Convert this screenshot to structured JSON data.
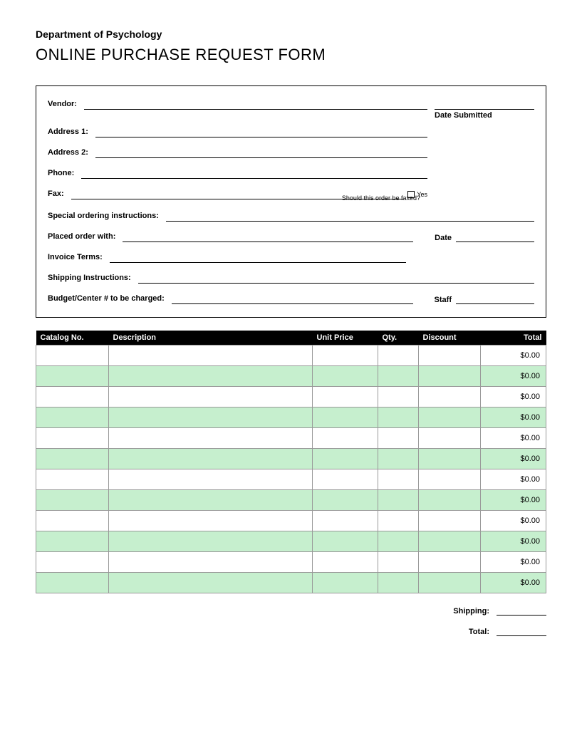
{
  "header": {
    "department": "Department of Psychology",
    "title": "ONLINE PURCHASE REQUEST FORM"
  },
  "form": {
    "vendor_label": "Vendor:",
    "date_submitted_label": "Date Submitted",
    "address1_label": "Address 1:",
    "address2_label": "Address 2:",
    "phone_label": "Phone:",
    "fax_label": "Fax:",
    "fax_yes": "Yes",
    "fax_hint": "Should this order be faxed?",
    "special_label": "Special ordering instructions:",
    "placed_label": "Placed order with:",
    "date_label": "Date",
    "invoice_label": "Invoice Terms:",
    "shipping_label": "Shipping Instructions:",
    "budget_label": "Budget/Center # to be charged:",
    "staff_label": "Staff"
  },
  "table": {
    "headers": {
      "catalog": "Catalog No.",
      "description": "Description",
      "unit_price": "Unit Price",
      "qty": "Qty.",
      "discount": "Discount",
      "total": "Total"
    },
    "rows": [
      {
        "catalog": "",
        "description": "",
        "unit_price": "",
        "qty": "",
        "discount": "",
        "total": "$0.00"
      },
      {
        "catalog": "",
        "description": "",
        "unit_price": "",
        "qty": "",
        "discount": "",
        "total": "$0.00"
      },
      {
        "catalog": "",
        "description": "",
        "unit_price": "",
        "qty": "",
        "discount": "",
        "total": "$0.00"
      },
      {
        "catalog": "",
        "description": "",
        "unit_price": "",
        "qty": "",
        "discount": "",
        "total": "$0.00"
      },
      {
        "catalog": "",
        "description": "",
        "unit_price": "",
        "qty": "",
        "discount": "",
        "total": "$0.00"
      },
      {
        "catalog": "",
        "description": "",
        "unit_price": "",
        "qty": "",
        "discount": "",
        "total": "$0.00"
      },
      {
        "catalog": "",
        "description": "",
        "unit_price": "",
        "qty": "",
        "discount": "",
        "total": "$0.00"
      },
      {
        "catalog": "",
        "description": "",
        "unit_price": "",
        "qty": "",
        "discount": "",
        "total": "$0.00"
      },
      {
        "catalog": "",
        "description": "",
        "unit_price": "",
        "qty": "",
        "discount": "",
        "total": "$0.00"
      },
      {
        "catalog": "",
        "description": "",
        "unit_price": "",
        "qty": "",
        "discount": "",
        "total": "$0.00"
      },
      {
        "catalog": "",
        "description": "",
        "unit_price": "",
        "qty": "",
        "discount": "",
        "total": "$0.00"
      },
      {
        "catalog": "",
        "description": "",
        "unit_price": "",
        "qty": "",
        "discount": "",
        "total": "$0.00"
      }
    ]
  },
  "totals": {
    "shipping_label": "Shipping:",
    "total_label": "Total:"
  }
}
